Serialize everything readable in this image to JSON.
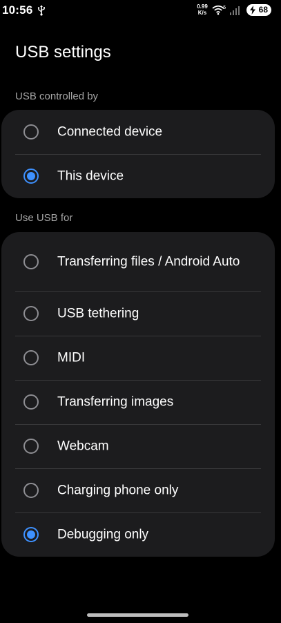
{
  "status_bar": {
    "time": "10:56",
    "net_speed_value": "0.99",
    "net_speed_unit": "K/s",
    "wifi_badge": "5",
    "battery_level": "68"
  },
  "page": {
    "title": "USB settings"
  },
  "usb_controlled_by": {
    "header": "USB controlled by",
    "options": [
      {
        "label": "Connected device",
        "selected": false
      },
      {
        "label": "This device",
        "selected": true
      }
    ]
  },
  "use_usb_for": {
    "header": "Use USB for",
    "options": [
      {
        "label": "Transferring files / Android Auto",
        "selected": false
      },
      {
        "label": "USB tethering",
        "selected": false
      },
      {
        "label": "MIDI",
        "selected": false
      },
      {
        "label": "Transferring images",
        "selected": false
      },
      {
        "label": "Webcam",
        "selected": false
      },
      {
        "label": "Charging phone only",
        "selected": false
      },
      {
        "label": "Debugging only",
        "selected": true
      }
    ]
  },
  "colors": {
    "background": "#000000",
    "card": "#1c1c1e",
    "accent": "#3e91ff",
    "secondary_text": "#a6a6a6"
  },
  "icons": {
    "usb": "usb-icon",
    "wifi": "wifi-icon",
    "signal": "signal-icon",
    "battery": "battery-charging-icon"
  }
}
